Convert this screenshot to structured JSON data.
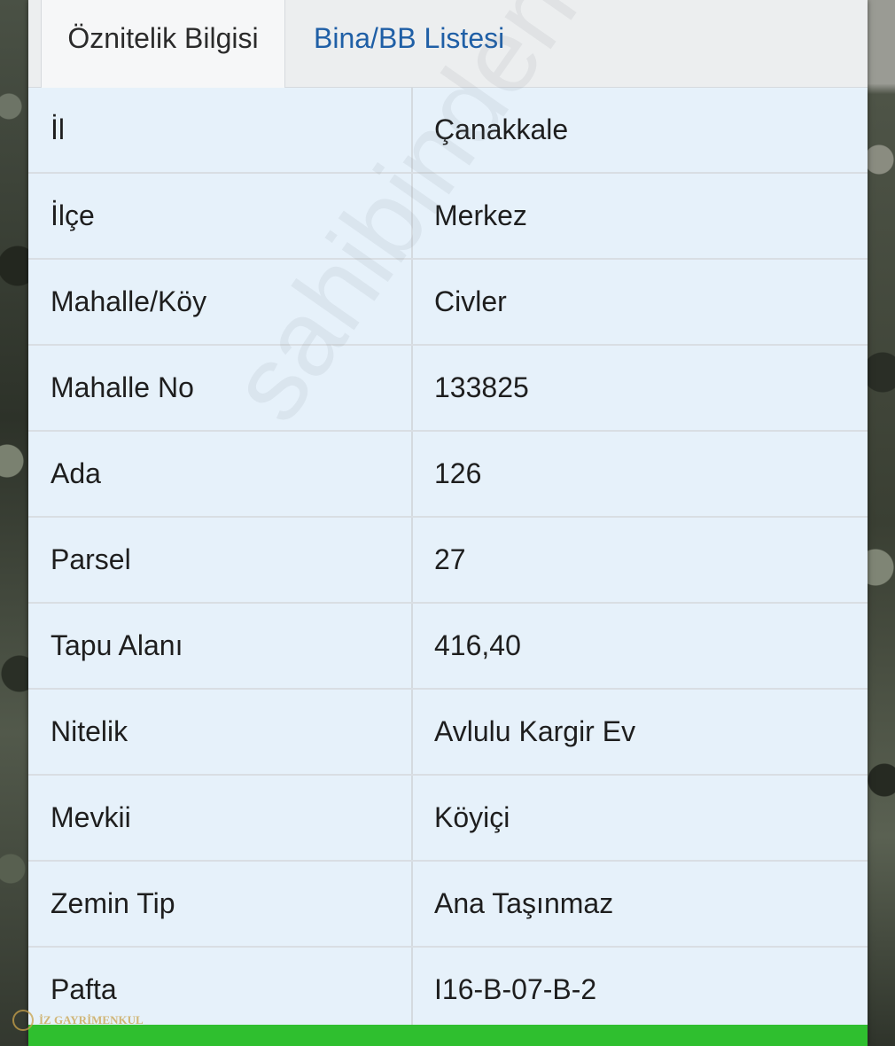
{
  "tabs": [
    {
      "label": "Öznitelik Bilgisi",
      "active": true
    },
    {
      "label": "Bina/BB Listesi",
      "active": false
    }
  ],
  "rows": [
    {
      "label": "İl",
      "value": "Çanakkale"
    },
    {
      "label": "İlçe",
      "value": "Merkez"
    },
    {
      "label": "Mahalle/Köy",
      "value": "Civler"
    },
    {
      "label": "Mahalle No",
      "value": "133825"
    },
    {
      "label": "Ada",
      "value": "126"
    },
    {
      "label": "Parsel",
      "value": "27"
    },
    {
      "label": "Tapu Alanı",
      "value": "416,40"
    },
    {
      "label": "Nitelik",
      "value": "Avlulu Kargir Ev"
    },
    {
      "label": "Mevkii",
      "value": "Köyiçi"
    },
    {
      "label": "Zemin Tip",
      "value": "Ana Taşınmaz"
    },
    {
      "label": "Pafta",
      "value": "I16-B-07-B-2"
    }
  ],
  "watermark": "sahibinden emlakjet.com",
  "logo_text": "İZ GAYRİMENKUL",
  "colors": {
    "tab_link": "#1f5fa6",
    "row_bg": "#e6f1fa",
    "bottom_bar": "#2fbf2f"
  }
}
